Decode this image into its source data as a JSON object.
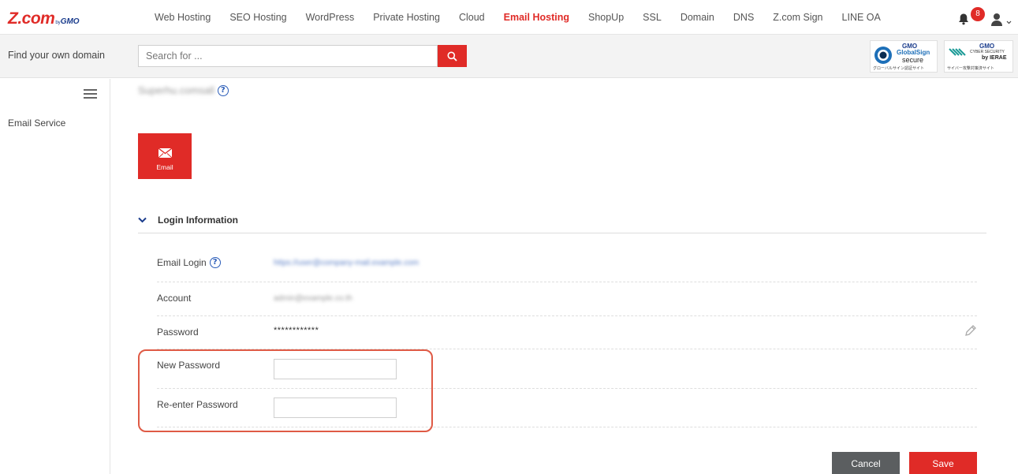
{
  "brand": {
    "name": "Z.com",
    "by": "by",
    "gmo": "GMO"
  },
  "nav": {
    "items": [
      {
        "label": "Web Hosting"
      },
      {
        "label": "SEO Hosting"
      },
      {
        "label": "WordPress"
      },
      {
        "label": "Private Hosting"
      },
      {
        "label": "Cloud"
      },
      {
        "label": "Email Hosting",
        "active": true
      },
      {
        "label": "ShopUp"
      },
      {
        "label": "SSL"
      },
      {
        "label": "Domain"
      },
      {
        "label": "DNS"
      },
      {
        "label": "Z.com Sign"
      },
      {
        "label": "LINE OA"
      }
    ],
    "notification_count": "8"
  },
  "search": {
    "label": "Find your own domain",
    "placeholder": "Search for ..."
  },
  "seals": {
    "globalsign": {
      "line1": "GMO",
      "line2": "GlobalSign",
      "line3": "secure",
      "line4": "グローバルサイン認証サイト"
    },
    "ierae": {
      "line1": "GMO",
      "line2": "CYBER SECURITY",
      "line3": "by IERAE",
      "line4": "サイバー攻撃対策済サイト"
    }
  },
  "sidebar": {
    "items": [
      {
        "label": "Email Service"
      }
    ]
  },
  "page": {
    "title_blurred": "Superhu.comsall",
    "tile_label": "Email"
  },
  "section": {
    "title": "Login Information"
  },
  "fields": {
    "email_login": {
      "label": "Email Login",
      "value": "https://user@company-mail.example.com"
    },
    "account": {
      "label": "Account",
      "value": "admin@example.co.th"
    },
    "password": {
      "label": "Password",
      "value": "************"
    },
    "new_password": {
      "label": "New Password",
      "value": ""
    },
    "reenter_password": {
      "label": "Re-enter Password",
      "value": ""
    }
  },
  "actions": {
    "cancel": "Cancel",
    "save": "Save"
  },
  "colors": {
    "brand_red": "#e02b27",
    "highlight": "#df5a45",
    "link_blue": "#2a5cb8",
    "cancel_gray": "#5b5e60"
  }
}
